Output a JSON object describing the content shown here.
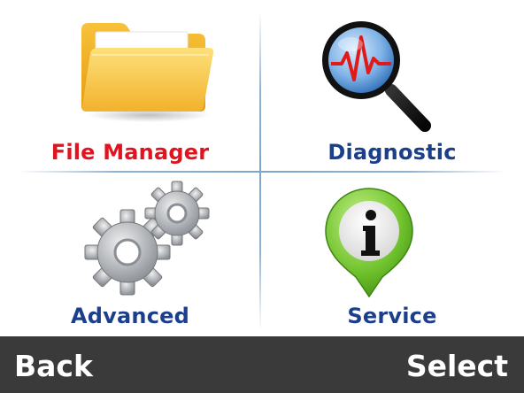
{
  "menu": {
    "items": [
      {
        "label": "File Manager",
        "icon": "folder-icon",
        "color": "#e0141e"
      },
      {
        "label": "Diagnostic",
        "icon": "magnifier-icon",
        "color": "#1c3f8c"
      },
      {
        "label": "Advanced",
        "icon": "gears-icon",
        "color": "#1c3f8c"
      },
      {
        "label": "Service",
        "icon": "info-pin-icon",
        "color": "#1c3f8c"
      }
    ],
    "selected_index": 0
  },
  "softkeys": {
    "left_label": "Back",
    "right_label": "Select"
  },
  "colors": {
    "selected_label": "#e0141e",
    "label": "#1c3f8c",
    "bottom_bar": "#3a3a3a"
  }
}
